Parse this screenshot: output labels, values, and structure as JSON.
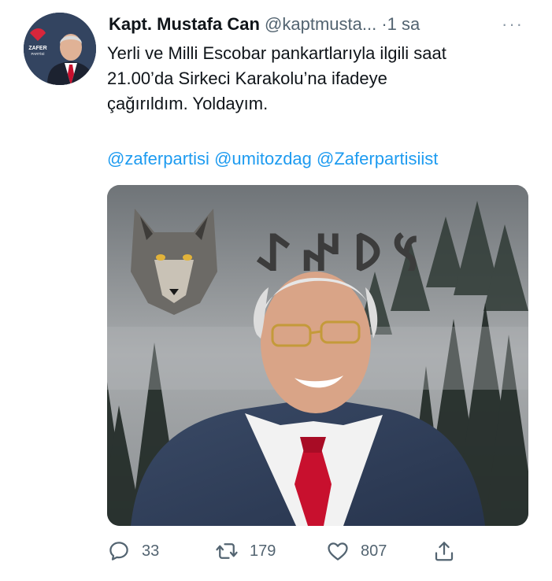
{
  "tweet": {
    "author": {
      "name": "Kapt. Mustafa Can",
      "handle": "@kaptmusta...",
      "separator": "·",
      "time": "1 sa",
      "avatar_party_label": "ZAFER",
      "avatar_party_sub": "PARTİSİ"
    },
    "more_label": "···",
    "text_lines": [
      "Yerli ve Milli Escobar pankartlarıyla ilgili saat",
      "21.00’da Sirkeci Karakolu’na ifadeye",
      "çağırıldım. Yoldayım."
    ],
    "mentions": [
      "@zaferpartisi",
      "@umitozdag",
      "@Zaferpartisiist"
    ],
    "media": {
      "overlay_glyphs": "𐰽𐰖𐰤𐰀",
      "icon": "photo-wolf-portrait"
    },
    "actions": {
      "reply": {
        "icon": "reply-icon",
        "count": "33"
      },
      "retweet": {
        "icon": "retweet-icon",
        "count": "179"
      },
      "like": {
        "icon": "heart-icon",
        "count": "807"
      },
      "share": {
        "icon": "share-icon"
      }
    },
    "colors": {
      "link": "#1d9bf0",
      "secondary_text": "#536471",
      "icon": "#536471",
      "tie": "#c8102e"
    }
  }
}
